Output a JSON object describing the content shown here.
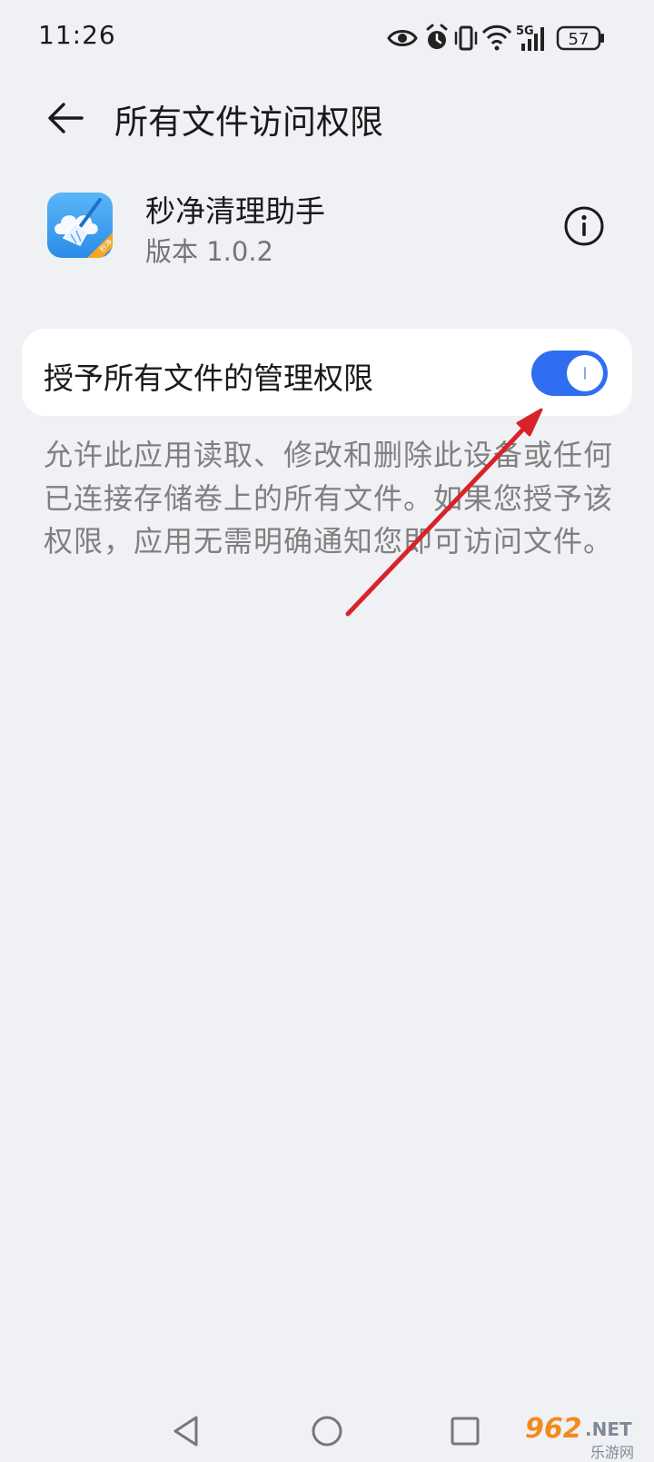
{
  "status_bar": {
    "time": "11:26",
    "battery": "57",
    "network": "5G",
    "icons": [
      "eye-icon",
      "alarm-icon",
      "vibrate-icon",
      "wifi-icon",
      "signal-icon",
      "battery-icon"
    ]
  },
  "header": {
    "title": "所有文件访问权限",
    "back_icon": "arrow-left-icon"
  },
  "app": {
    "name": "秒净清理助手",
    "version": "版本 1.0.2",
    "icon": "broom-cloud-app-icon",
    "icon_badge": "秒净",
    "info_icon": "info-icon"
  },
  "setting": {
    "label": "授予所有文件的管理权限",
    "enabled": true,
    "accent_color": "#2f6ef1"
  },
  "description": "允许此应用读取、修改和删除此设备或任何已连接存储卷上的所有文件。如果您授予该权限，应用无需明确通知您即可访问文件。",
  "nav_bar": {
    "back": "triangle-back-icon",
    "home": "circle-home-icon",
    "recents": "square-recents-icon"
  },
  "watermark": {
    "number": "962",
    "suffix": ".NET",
    "chinese": "乐游网"
  },
  "annotation": {
    "color": "#d8232a",
    "shape": "arrow-pointing-to-toggle"
  }
}
